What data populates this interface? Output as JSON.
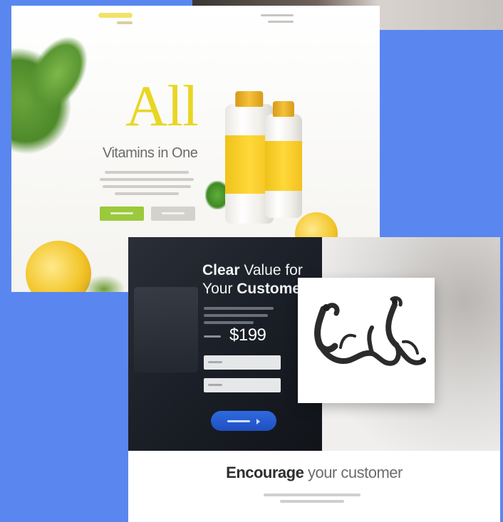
{
  "colors": {
    "background": "#5a86f0",
    "vitamin_yellow": "#e9d623",
    "button_green": "#9bc93c",
    "dark_panel": "#1b1f27",
    "cta_blue": "#2f6ae0"
  },
  "vitamin_card": {
    "title": "All",
    "subtitle": "Vitamins in One"
  },
  "landing_card": {
    "title_bold_1": "Clear",
    "title_normal_1": " Value for",
    "title_normal_2": "Your ",
    "title_bold_2": "Customer",
    "price": "$199",
    "heading_bold": "Encourage",
    "heading_normal": " your customer"
  },
  "icons": {
    "sketch": "climber-sketch-icon",
    "steering": "steering-wheel-icon"
  }
}
